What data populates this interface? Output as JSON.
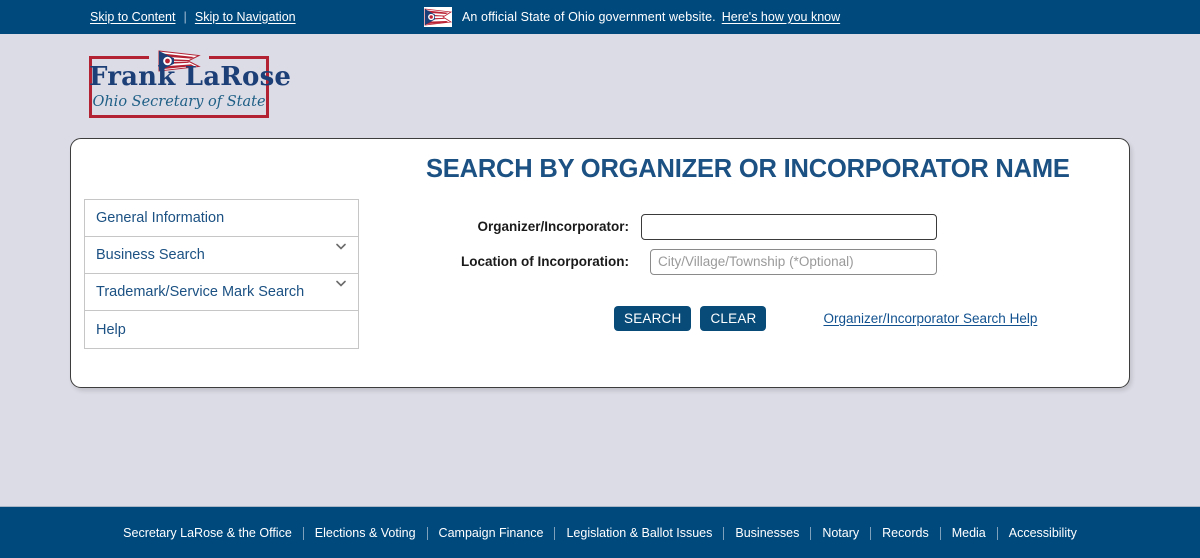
{
  "gov_banner": {
    "skip_to_content": "Skip to Content",
    "skip_divider": "|",
    "skip_to_navigation": "Skip to Navigation",
    "flag_icon": "ohio-flag-icon",
    "notice_text": "An official State of Ohio government website.",
    "notice_link": "Here's how you know"
  },
  "logo": {
    "flag_icon": "ohio-flag-burgee-icon",
    "name": "Frank LaRose",
    "subtitle": "Ohio Secretary of State",
    "frame_color": "#b32233",
    "name_color": "#1d3f77",
    "subtitle_color": "#1f5f86"
  },
  "main": {
    "title": "SEARCH BY ORGANIZER OR INCORPORATOR NAME",
    "title_color": "#1b5183"
  },
  "sidebar": {
    "items": [
      {
        "label": "General Information",
        "caret": false
      },
      {
        "label": "Business Search",
        "caret": true,
        "caret_icon": "chevron-down-icon"
      },
      {
        "label": "Trademark/Service Mark Search",
        "caret": true,
        "caret_icon": "chevron-down-icon"
      },
      {
        "label": "Help",
        "caret": false
      }
    ]
  },
  "form": {
    "organizer": {
      "label": "Organizer/Incorporator:",
      "value": "",
      "placeholder": ""
    },
    "location": {
      "label": "Location of Incorporation:",
      "value": "",
      "placeholder": "City/Village/Township (*Optional)"
    },
    "search_button": "SEARCH",
    "clear_button": "CLEAR",
    "help_link": "Organizer/Incorporator Search Help",
    "button_color": "#084b79",
    "link_color": "#11518f"
  },
  "footer": {
    "links": [
      "Secretary LaRose & the Office",
      "Elections & Voting",
      "Campaign Finance",
      "Legislation & Ballot Issues",
      "Businesses",
      "Notary",
      "Records",
      "Media",
      "Accessibility"
    ],
    "background_color": "#00497d"
  }
}
